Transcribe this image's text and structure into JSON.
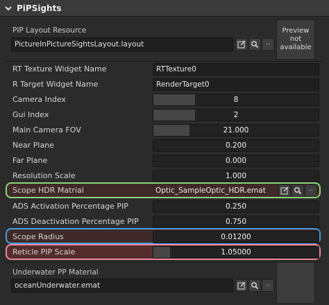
{
  "header": {
    "title": "PiPSights"
  },
  "layout_resource": {
    "label": "PIP Layout Resource",
    "value": "PictureInPictureSightsLayout.layout"
  },
  "preview_top": {
    "text": "Preview\nnot\navailable"
  },
  "rows": [
    {
      "label": "RT Texture Widget Name",
      "value": "RTTexture0"
    },
    {
      "label": "R Target Widget Name",
      "value": "RenderTarget0"
    },
    {
      "label": "Camera Index",
      "value": "8",
      "fill": 0.25
    },
    {
      "label": "Gui Index",
      "value": "2",
      "fill": 0.25
    },
    {
      "label": "Main Camera FOV",
      "value": "21.000",
      "fill": 0.22
    },
    {
      "label": "Near Plane",
      "value": "0.200",
      "fill": 0.0
    },
    {
      "label": "Far Plane",
      "value": "0.000",
      "fill": 0.0
    },
    {
      "label": "Resolution Scale",
      "value": "1.000",
      "fill": 0.0
    },
    {
      "label": "Scope HDR Matrial",
      "value": "Optic_SampleOptic_HDR.emat"
    },
    {
      "label": "ADS Activation Percentage PIP",
      "value": "0.250",
      "fill": 0.0
    },
    {
      "label": "ADS Deactivation Percentage PIP",
      "value": "0.750",
      "fill": 0.0
    },
    {
      "label": "Scope Radius",
      "value": "0.01200",
      "fill": 0.0
    },
    {
      "label": "Reticle PIP Scale",
      "value": "1.05000",
      "fill": 0.1
    }
  ],
  "underwater": {
    "label": "Underwater PP Material",
    "value": "oceanUnderwater.emat"
  },
  "buttons": {
    "more": ".."
  },
  "colors": {
    "highlight_green": "#8fd47a",
    "highlight_blue": "#4a9fe0",
    "highlight_pink": "#ef8aa0"
  }
}
